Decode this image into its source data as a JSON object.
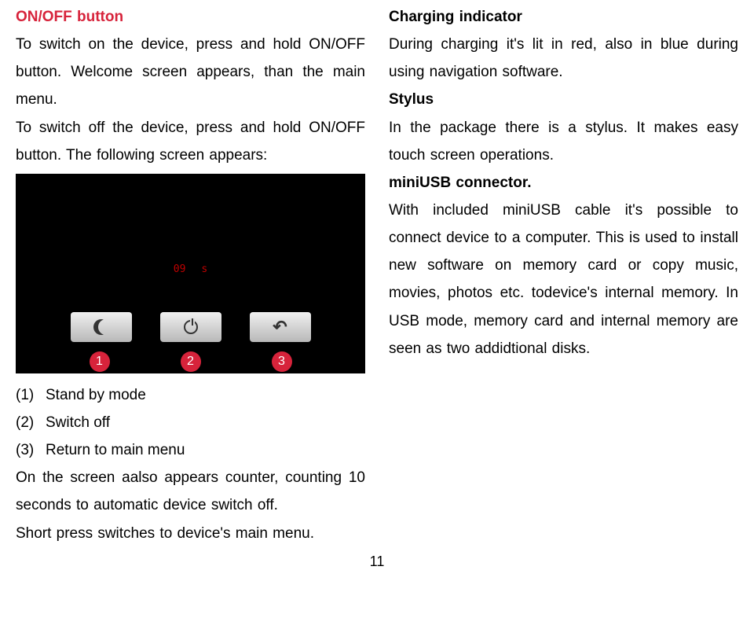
{
  "left": {
    "heading": "ON/OFF button",
    "p1": "To switch on the device, press and hold ON/OFF button. Welcome screen appears, than the main menu.",
    "p2": "To switch off the device, press and hold ON/OFF button. The following screen appears:",
    "counter_num": "09",
    "counter_unit": "s",
    "badge1": "1",
    "badge2": "2",
    "badge3": "3",
    "li1_num": "(1)",
    "li1_text": "Stand by mode",
    "li2_num": "(2)",
    "li2_text": "Switch off",
    "li3_num": "(3)",
    "li3_text": "Return to main menu",
    "p3": "On the screen aalso appears counter, counting 10 seconds to automatic device switch off.",
    "p4": "Short press switches to device's main menu."
  },
  "right": {
    "h1": "Charging indicator",
    "p1": "During charging it's lit in red, also in blue during using navigation software.",
    "h2": "Stylus",
    "p2": "In the package there is a stylus. It makes easy touch screen operations.",
    "h3": "miniUSB connector.",
    "p3": "With included miniUSB cable it's possible to connect device to a computer. This is used to install new software on memory card or copy music, movies, photos etc. todevice's internal memory. In USB mode, memory card and internal memory are seen as two addidtional disks."
  },
  "page_number": "11"
}
